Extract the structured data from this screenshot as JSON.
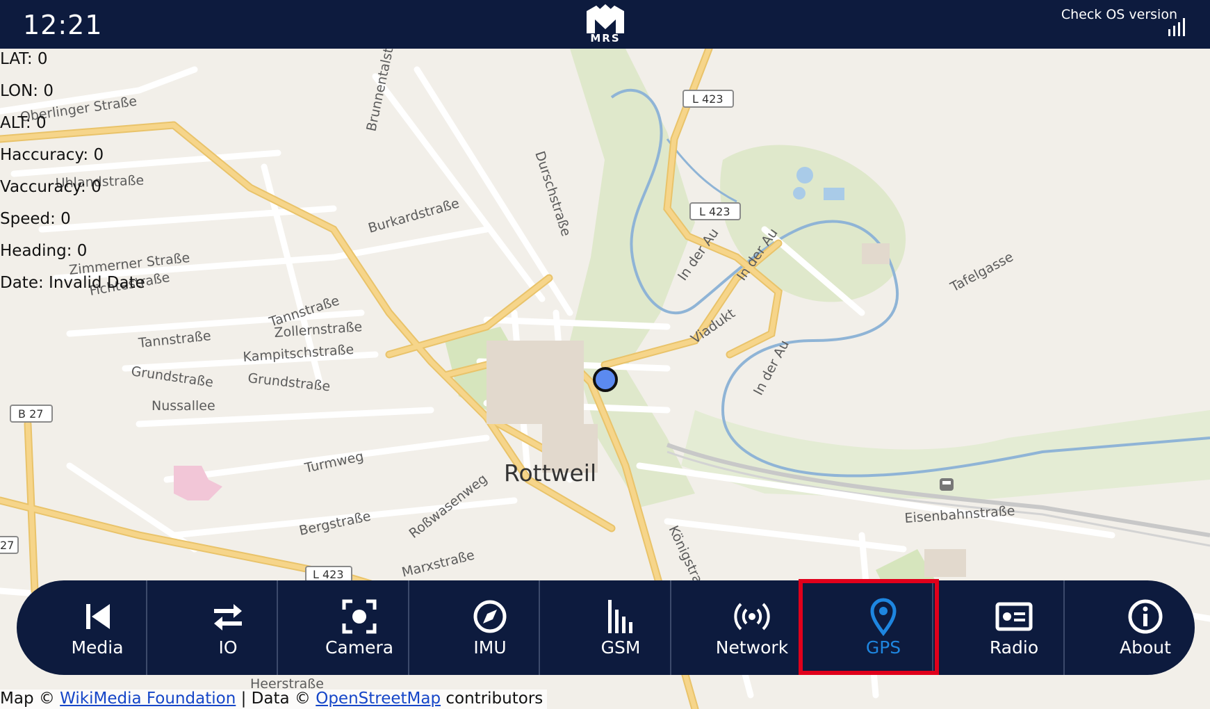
{
  "statusbar": {
    "time": "12:21",
    "logo_text": "MRS",
    "os_version_label": "Check OS version"
  },
  "gps": {
    "rows": [
      {
        "label": "LAT: 0"
      },
      {
        "label": "LON: 0"
      },
      {
        "label": "ALT: 0"
      },
      {
        "label": "Haccuracy: 0"
      },
      {
        "label": "Vaccuracy: 0"
      },
      {
        "label": "Speed: 0"
      },
      {
        "label": "Heading: 0"
      },
      {
        "label": "Date: Invalid Date"
      }
    ]
  },
  "map": {
    "city": "Rottweil",
    "streets": [
      "Oberlinger Straße",
      "Brunnentalstraße",
      "Durschstraße",
      "Burkardstraße",
      "Zimmerner Straße",
      "Fichtestraße",
      "Tannstraße",
      "Zollernstraße",
      "Kampitschstraße",
      "Grundstraße",
      "Nussallee",
      "Turmweg",
      "Bergstraße",
      "Roßwasenweg",
      "Marxstraße",
      "Königstraße",
      "In der Au",
      "Viadukt",
      "Tafelgasse",
      "Eisenbahnstraße",
      "Heerstraße",
      "Uhlandstraße"
    ],
    "road_shields": [
      "L 423",
      "L 423",
      "B 27",
      "27",
      "L 423"
    ],
    "colors": {
      "road_major": "#f6d58a",
      "water": "#8fb4d6",
      "green": "#d6e5bd",
      "background": "#f2efe9"
    }
  },
  "nav": {
    "items": [
      {
        "label": "Media",
        "icon": "skip-previous-icon"
      },
      {
        "label": "IO",
        "icon": "swap-arrows-icon"
      },
      {
        "label": "Camera",
        "icon": "camera-focus-icon"
      },
      {
        "label": "IMU",
        "icon": "compass-icon"
      },
      {
        "label": "GSM",
        "icon": "signal-bars-icon"
      },
      {
        "label": "Network",
        "icon": "wireless-broadcast-icon"
      },
      {
        "label": "GPS",
        "icon": "map-pin-icon"
      },
      {
        "label": "Radio",
        "icon": "radio-icon"
      },
      {
        "label": "About",
        "icon": "info-icon"
      }
    ],
    "active": "GPS",
    "colors": {
      "bg": "#0d1b3e",
      "active": "#1e86e0",
      "highlight": "#e0001b"
    }
  },
  "attribution": {
    "prefix": "Map © ",
    "wikimedia": "WikiMedia Foundation",
    "middle": " | Data © ",
    "osm": "OpenStreetMap",
    "suffix": " contributors"
  }
}
